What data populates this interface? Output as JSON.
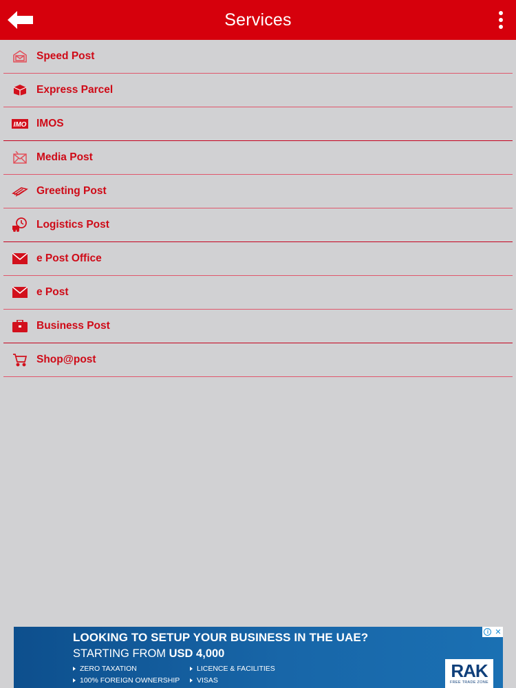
{
  "header": {
    "title": "Services",
    "back_icon": "back-arrow-icon",
    "menu_icon": "more-vertical-icon",
    "color": "#d6000c"
  },
  "services": [
    {
      "label": "Speed Post",
      "icon": "speed-post-icon"
    },
    {
      "label": "Express Parcel",
      "icon": "parcel-icon"
    },
    {
      "label": "IMOS",
      "icon": "imos-icon",
      "icon_text": "IMO"
    },
    {
      "label": "Media Post",
      "icon": "media-post-icon"
    },
    {
      "label": "Greeting Post",
      "icon": "greeting-post-icon"
    },
    {
      "label": "Logistics Post",
      "icon": "logistics-post-icon"
    },
    {
      "label": "e Post Office",
      "icon": "envelope-icon"
    },
    {
      "label": "e Post",
      "icon": "envelope-icon"
    },
    {
      "label": "Business Post",
      "icon": "briefcase-icon"
    },
    {
      "label": "Shop@post",
      "icon": "shopping-cart-icon"
    }
  ],
  "ad": {
    "headline": "LOOKING TO SETUP YOUR BUSINESS IN THE UAE?",
    "sub_prefix": "STARTING FROM ",
    "sub_amount": "USD 4,000",
    "bullets": [
      "ZERO TAXATION",
      "LICENCE & FACILITIES",
      "100% FOREIGN OWNERSHIP",
      "VISAS"
    ],
    "logo_main": "RAK",
    "logo_sub": "FREE TRADE ZONE",
    "choices_close": "✕"
  },
  "colors": {
    "accent": "#cf0a17",
    "background": "#d1d1d3",
    "ad_blue": "#1866a8"
  }
}
